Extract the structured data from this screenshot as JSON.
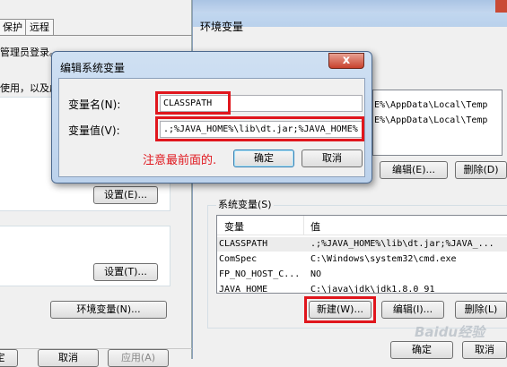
{
  "sysprops": {
    "tabs": [
      "保护",
      "远程"
    ],
    "text_line1": "管理员登录。",
    "text_line2": "使用，以及虚",
    "settings_button1": "设置(E)...",
    "settings_button2": "设置(T)...",
    "env_button": "环境变量(N)...",
    "bottom_buttons": [
      "定",
      "取消",
      "应用(A)"
    ]
  },
  "envwin": {
    "title": "环境变量",
    "user_rows": [
      "E%\\AppData\\Local\\Temp",
      "E%\\AppData\\Local\\Temp"
    ],
    "user_edit": "编辑(E)...",
    "user_delete": "删除(D)",
    "system_group_label": "系统变量(S)",
    "col_variable": "变量",
    "col_value": "值",
    "system_rows": [
      {
        "name": "CLASSPATH",
        "value": ".;%JAVA_HOME%\\lib\\dt.jar;%JAVA_..."
      },
      {
        "name": "ComSpec",
        "value": "C:\\Windows\\system32\\cmd.exe"
      },
      {
        "name": "FP_NO_HOST_C...",
        "value": "NO"
      },
      {
        "name": "JAVA_HOME",
        "value": "C:\\java\\jdk\\jdk1.8.0_91"
      }
    ],
    "new_button": "新建(W)...",
    "edit_button": "编辑(I)...",
    "delete_button": "删除(L)",
    "ok_button": "确定",
    "cancel_button": "取消"
  },
  "dialog": {
    "title": "编辑系统变量",
    "close_glyph": "x",
    "name_label": "变量名(N):",
    "name_value": "CLASSPATH",
    "value_label": "变量值(V):",
    "value_value": ".;%JAVA_HOME%\\lib\\dt.jar;%JAVA_HOME%",
    "note": "注意最前面的.",
    "ok": "确定",
    "cancel": "取消"
  },
  "watermark": "Baidu经验",
  "colors": {
    "highlight": "#e0161d",
    "titlebar": "#bcd2ec"
  }
}
